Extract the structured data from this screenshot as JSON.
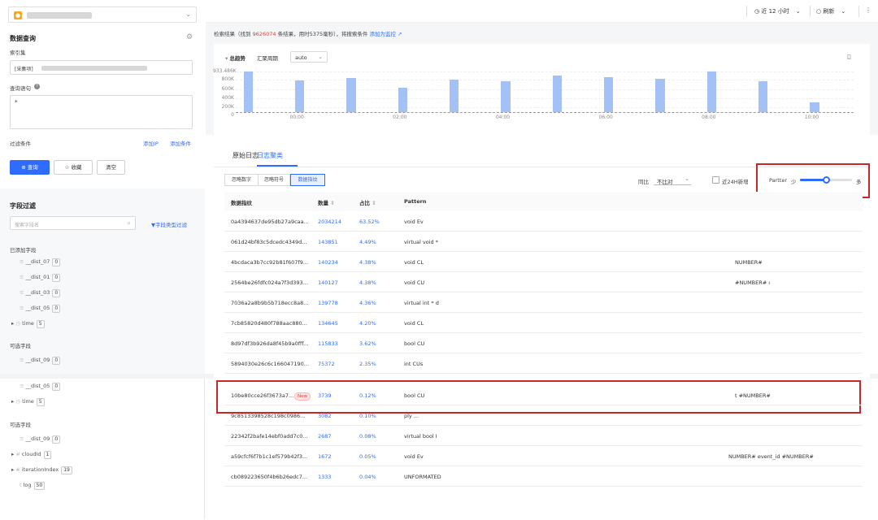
{
  "sidebar": {
    "title": "数据查询",
    "index_label": "索引集",
    "index_value": "[采集项]",
    "query_label": "查询语句",
    "query_value": "*",
    "filter_label": "过滤条件",
    "add_ip": "添加IP",
    "add_condition": "添加条件",
    "query_btn": "查询",
    "fav_btn": "收藏",
    "clear_btn": "清空",
    "field_filter_title": "字段过滤",
    "search_placeholder": "搜索字段名",
    "type_filter": "字段类型过滤",
    "added_fields_label": "已添加字段",
    "optional_fields_label": "可选字段",
    "added_fields": [
      {
        "name": "__dist_07",
        "count": "0"
      },
      {
        "name": "__dist_01",
        "count": "0"
      },
      {
        "name": "__dist_03",
        "count": "0"
      },
      {
        "name": "__dist_05",
        "count": "0"
      },
      {
        "name": "time",
        "count": "5"
      }
    ],
    "optional_fields_top": [
      {
        "name": "__dist_09",
        "count": "0"
      }
    ],
    "lower_fields": [
      {
        "name": "__dist_05",
        "count": "0"
      },
      {
        "name": "time",
        "count": "5"
      }
    ],
    "lower_optional_label": "可选字段",
    "lower_optional": [
      {
        "name": "__dist_09",
        "count": "0"
      },
      {
        "name": "cloudId",
        "count": "1"
      },
      {
        "name": "iterationIndex",
        "count": "19"
      },
      {
        "name": "log",
        "count": "50"
      }
    ]
  },
  "topbar": {
    "time_range": "近 12 小时",
    "refresh": "刷新"
  },
  "result_bar": {
    "prefix": "检索结果（找到",
    "count": "9626074",
    "middle": "条结果，用时5375毫秒），将搜索条件",
    "link": "添加为监控"
  },
  "chart_header": {
    "title": "总趋势",
    "period_label": "汇聚周期",
    "period_value": "auto"
  },
  "chart_data": {
    "type": "bar",
    "y_ticks": [
      "933.486K",
      "800K",
      "600K",
      "400K",
      "200K",
      "0"
    ],
    "x_ticks": [
      "00:00",
      "02:00",
      "04:00",
      "06:00",
      "08:00",
      "10:00"
    ],
    "ylim": [
      0,
      933486
    ],
    "values": [
      933000,
      725000,
      780000,
      555000,
      745000,
      715000,
      845000,
      805000,
      760000,
      925000,
      710000,
      230000
    ]
  },
  "tabs": [
    "原始日志",
    "日志聚类"
  ],
  "seg_buttons": [
    "忽略数字",
    "忽略符号",
    "数据指纹"
  ],
  "compare": {
    "label": "同比",
    "value": "不比对",
    "new24h": "近24H新增",
    "partter_label": "Partter",
    "less": "少",
    "more": "多",
    "slider_level": 0.5
  },
  "table": {
    "headers": [
      "数据指纹",
      "数量",
      "占比",
      "Pattern"
    ],
    "rows": [
      {
        "fp": "0a4394637de95db27a9caa...",
        "count": "2034214",
        "pct": "63.52%",
        "pattern": "void Ev",
        "extra": ""
      },
      {
        "fp": "061d24bf83c5dcedc4349d...",
        "count": "143851",
        "pct": "4.49%",
        "pattern": "virtual void *",
        "extra": ""
      },
      {
        "fp": "4bcdaca3b7cc92b81f607f9...",
        "count": "140234",
        "pct": "4.38%",
        "pattern": "void CL",
        "extra": "NUMBER#"
      },
      {
        "fp": "2564be26fdfc024a7f3d393...",
        "count": "140127",
        "pct": "4.38%",
        "pattern": "void CU",
        "extra": "#NUMBER# ı"
      },
      {
        "fp": "7036a2a8b9b5b718ecc8a8...",
        "count": "139778",
        "pct": "4.36%",
        "pattern": "virtual int * d",
        "extra": ""
      },
      {
        "fp": "7cb85820d480f788aac880...",
        "count": "134645",
        "pct": "4.20%",
        "pattern": "void CL",
        "extra": ""
      },
      {
        "fp": "8d97df3b926da8f45b9a0fff...",
        "count": "115833",
        "pct": "3.62%",
        "pattern": "bool CU",
        "extra": ""
      },
      {
        "fp": "5894030e26c6c166047190...",
        "count": "75372",
        "pct": "2.35%",
        "pattern": "int CUs",
        "extra": ""
      }
    ],
    "lower_rows": [
      {
        "fp": "10be80cce26f3673a7...",
        "new": "New",
        "count": "3739",
        "pct": "0.12%",
        "pattern": "bool CU",
        "extra": "t #NUMBER#"
      },
      {
        "fp": "9c8513398528c198c0986...",
        "count": "3082",
        "pct": "0.10%",
        "pattern": "ply ...",
        "extra": ""
      },
      {
        "fp": "22342f2bafe14ebf0add7c0...",
        "count": "2687",
        "pct": "0.08%",
        "pattern": "virtual bool I",
        "extra": ""
      },
      {
        "fp": "a59cfcf6f7b1c1ef579b42f3...",
        "count": "1672",
        "pct": "0.05%",
        "pattern": "void Ev",
        "extra": "NUMBER# event_id #NUMBER#"
      },
      {
        "fp": "cb089223650f4b6b26edc7...",
        "count": "1333",
        "pct": "0.04%",
        "pattern": "UNFORMATED",
        "extra": ""
      }
    ]
  }
}
